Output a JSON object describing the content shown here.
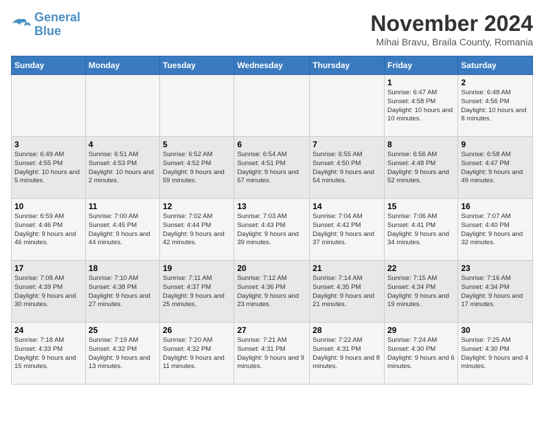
{
  "logo": {
    "line1": "General",
    "line2": "Blue"
  },
  "title": "November 2024",
  "location": "Mihai Bravu, Braila County, Romania",
  "headers": [
    "Sunday",
    "Monday",
    "Tuesday",
    "Wednesday",
    "Thursday",
    "Friday",
    "Saturday"
  ],
  "weeks": [
    [
      {
        "day": "",
        "info": ""
      },
      {
        "day": "",
        "info": ""
      },
      {
        "day": "",
        "info": ""
      },
      {
        "day": "",
        "info": ""
      },
      {
        "day": "",
        "info": ""
      },
      {
        "day": "1",
        "info": "Sunrise: 6:47 AM\nSunset: 4:58 PM\nDaylight: 10 hours and 10 minutes."
      },
      {
        "day": "2",
        "info": "Sunrise: 6:48 AM\nSunset: 4:56 PM\nDaylight: 10 hours and 8 minutes."
      }
    ],
    [
      {
        "day": "3",
        "info": "Sunrise: 6:49 AM\nSunset: 4:55 PM\nDaylight: 10 hours and 5 minutes."
      },
      {
        "day": "4",
        "info": "Sunrise: 6:51 AM\nSunset: 4:53 PM\nDaylight: 10 hours and 2 minutes."
      },
      {
        "day": "5",
        "info": "Sunrise: 6:52 AM\nSunset: 4:52 PM\nDaylight: 9 hours and 59 minutes."
      },
      {
        "day": "6",
        "info": "Sunrise: 6:54 AM\nSunset: 4:51 PM\nDaylight: 9 hours and 57 minutes."
      },
      {
        "day": "7",
        "info": "Sunrise: 6:55 AM\nSunset: 4:50 PM\nDaylight: 9 hours and 54 minutes."
      },
      {
        "day": "8",
        "info": "Sunrise: 6:56 AM\nSunset: 4:48 PM\nDaylight: 9 hours and 52 minutes."
      },
      {
        "day": "9",
        "info": "Sunrise: 6:58 AM\nSunset: 4:47 PM\nDaylight: 9 hours and 49 minutes."
      }
    ],
    [
      {
        "day": "10",
        "info": "Sunrise: 6:59 AM\nSunset: 4:46 PM\nDaylight: 9 hours and 46 minutes."
      },
      {
        "day": "11",
        "info": "Sunrise: 7:00 AM\nSunset: 4:45 PM\nDaylight: 9 hours and 44 minutes."
      },
      {
        "day": "12",
        "info": "Sunrise: 7:02 AM\nSunset: 4:44 PM\nDaylight: 9 hours and 42 minutes."
      },
      {
        "day": "13",
        "info": "Sunrise: 7:03 AM\nSunset: 4:43 PM\nDaylight: 9 hours and 39 minutes."
      },
      {
        "day": "14",
        "info": "Sunrise: 7:04 AM\nSunset: 4:42 PM\nDaylight: 9 hours and 37 minutes."
      },
      {
        "day": "15",
        "info": "Sunrise: 7:06 AM\nSunset: 4:41 PM\nDaylight: 9 hours and 34 minutes."
      },
      {
        "day": "16",
        "info": "Sunrise: 7:07 AM\nSunset: 4:40 PM\nDaylight: 9 hours and 32 minutes."
      }
    ],
    [
      {
        "day": "17",
        "info": "Sunrise: 7:08 AM\nSunset: 4:39 PM\nDaylight: 9 hours and 30 minutes."
      },
      {
        "day": "18",
        "info": "Sunrise: 7:10 AM\nSunset: 4:38 PM\nDaylight: 9 hours and 27 minutes."
      },
      {
        "day": "19",
        "info": "Sunrise: 7:11 AM\nSunset: 4:37 PM\nDaylight: 9 hours and 25 minutes."
      },
      {
        "day": "20",
        "info": "Sunrise: 7:12 AM\nSunset: 4:36 PM\nDaylight: 9 hours and 23 minutes."
      },
      {
        "day": "21",
        "info": "Sunrise: 7:14 AM\nSunset: 4:35 PM\nDaylight: 9 hours and 21 minutes."
      },
      {
        "day": "22",
        "info": "Sunrise: 7:15 AM\nSunset: 4:34 PM\nDaylight: 9 hours and 19 minutes."
      },
      {
        "day": "23",
        "info": "Sunrise: 7:16 AM\nSunset: 4:34 PM\nDaylight: 9 hours and 17 minutes."
      }
    ],
    [
      {
        "day": "24",
        "info": "Sunrise: 7:18 AM\nSunset: 4:33 PM\nDaylight: 9 hours and 15 minutes."
      },
      {
        "day": "25",
        "info": "Sunrise: 7:19 AM\nSunset: 4:32 PM\nDaylight: 9 hours and 13 minutes."
      },
      {
        "day": "26",
        "info": "Sunrise: 7:20 AM\nSunset: 4:32 PM\nDaylight: 9 hours and 11 minutes."
      },
      {
        "day": "27",
        "info": "Sunrise: 7:21 AM\nSunset: 4:31 PM\nDaylight: 9 hours and 9 minutes."
      },
      {
        "day": "28",
        "info": "Sunrise: 7:22 AM\nSunset: 4:31 PM\nDaylight: 9 hours and 8 minutes."
      },
      {
        "day": "29",
        "info": "Sunrise: 7:24 AM\nSunset: 4:30 PM\nDaylight: 9 hours and 6 minutes."
      },
      {
        "day": "30",
        "info": "Sunrise: 7:25 AM\nSunset: 4:30 PM\nDaylight: 9 hours and 4 minutes."
      }
    ]
  ]
}
